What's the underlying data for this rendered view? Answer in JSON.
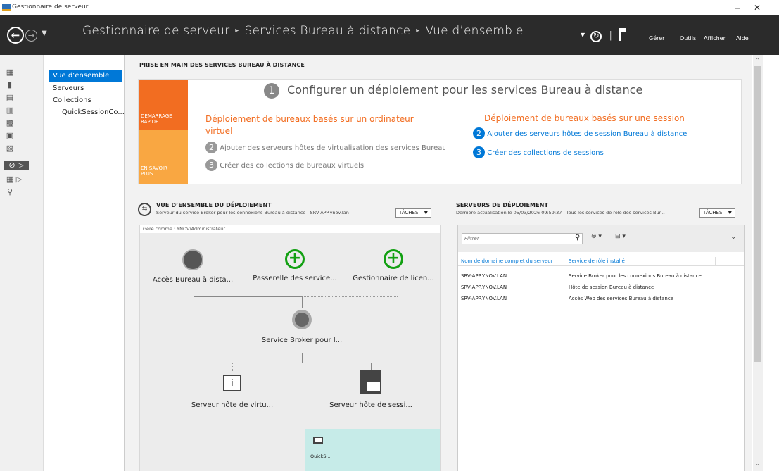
{
  "window": {
    "title": "Gestionnaire de serveur",
    "min": "—",
    "max": "❐",
    "close": "✕"
  },
  "header": {
    "crumbs": [
      "Gestionnaire de serveur",
      "Services Bureau à distance",
      "Vue d’ensemble"
    ],
    "menu": {
      "gerer": "Gérer",
      "outils": "Outils",
      "afficher": "Afficher",
      "aide": "Aide"
    }
  },
  "tree": {
    "items": [
      "Vue d’ensemble",
      "Serveurs",
      "Collections",
      "QuickSessionCo..."
    ]
  },
  "quickstart": {
    "section_title": "PRISE EN MAIN DES SERVICES BUREAU À DISTANCE",
    "tile1": "DÉMARRAGE RAPIDE",
    "tile2": "EN SAVOIR PLUS",
    "step1_num": "1",
    "step1": "Configurer un déploiement pour les services Bureau à distance",
    "left_title": "Déploiement de bureaux basés sur un ordinateur virtuel",
    "left_step2_num": "2",
    "left_step2": "Ajouter des serveurs hôtes de virtualisation des services Bureau",
    "left_step3_num": "3",
    "left_step3": "Créer des collections de bureaux virtuels",
    "right_title": "Déploiement de bureaux basés sur une session",
    "right_step2_num": "2",
    "right_step2": "Ajouter des serveurs hôtes de session Bureau à distance",
    "right_step3_num": "3",
    "right_step3": "Créer des collections de sessions"
  },
  "deployment": {
    "title": "VUE D’ENSEMBLE DU DÉPLOIEMENT",
    "subtitle": "Serveur du service Broker pour les connexions Bureau à distance : SRV-APP.ynov.lan",
    "tasks": "TÂCHES",
    "managed_as": "Géré comme : YNOV\\Administrateur",
    "nodes": {
      "access": "Accès Bureau à dista...",
      "gateway": "Passerelle des service...",
      "license": "Gestionnaire de licen...",
      "broker": "Service Broker pour l...",
      "virt": "Serveur hôte de virtu...",
      "session": "Serveur hôte de sessi...",
      "collection": "QuickS..."
    }
  },
  "servers": {
    "title": "SERVEURS DE DÉPLOIEMENT",
    "subtitle": "Dernière actualisation le 05/03/2026 09:59:37 | Tous les services de rôle des services Bur...",
    "tasks": "TÂCHES",
    "filter_placeholder": "Filtrer",
    "columns": [
      "Nom de domaine complet du serveur",
      "Service de rôle installé"
    ],
    "rows": [
      [
        "SRV-APP.YNOV.LAN",
        "Service Broker pour les connexions Bureau à distance"
      ],
      [
        "SRV-APP.YNOV.LAN",
        "Hôte de session Bureau à distance"
      ],
      [
        "SRV-APP.YNOV.LAN",
        "Accès Web des services Bureau à distance"
      ]
    ]
  },
  "colors": {
    "accent": "#0078d7",
    "orange": "#f26d21",
    "light_orange": "#f9a742",
    "header": "#2b2b2b",
    "green": "#12a012"
  }
}
